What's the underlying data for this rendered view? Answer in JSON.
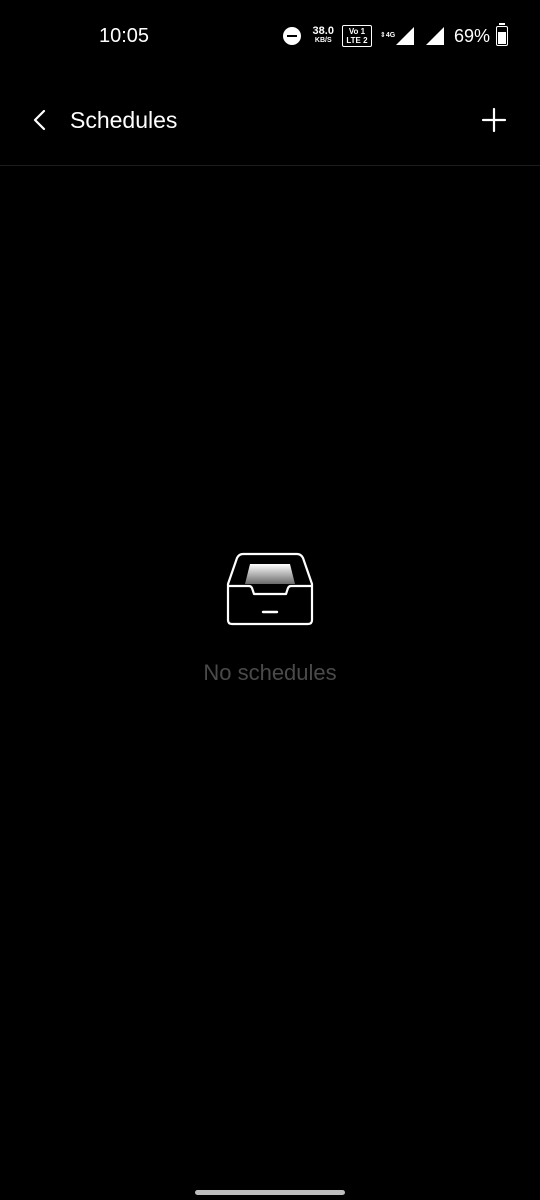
{
  "status_bar": {
    "time": "10:05",
    "net_speed_value": "38.0",
    "net_speed_unit": "KB/S",
    "volte_line1": "Vo 1",
    "volte_line2": "LTE 2",
    "network_type": "4G",
    "battery_percent": "69%",
    "battery_level": 0.69,
    "icons": [
      "do-not-disturb-icon",
      "volte-icon",
      "signal-icon",
      "battery-icon"
    ]
  },
  "app_bar": {
    "title": "Schedules",
    "back_icon": "chevron-left-icon",
    "add_icon": "plus-icon"
  },
  "empty_state": {
    "icon": "inbox-tray-icon",
    "message": "No schedules"
  },
  "colors": {
    "background": "#000000",
    "text_primary": "#ffffff",
    "text_muted": "#4a4a4a",
    "divider": "#1c1c1c"
  }
}
